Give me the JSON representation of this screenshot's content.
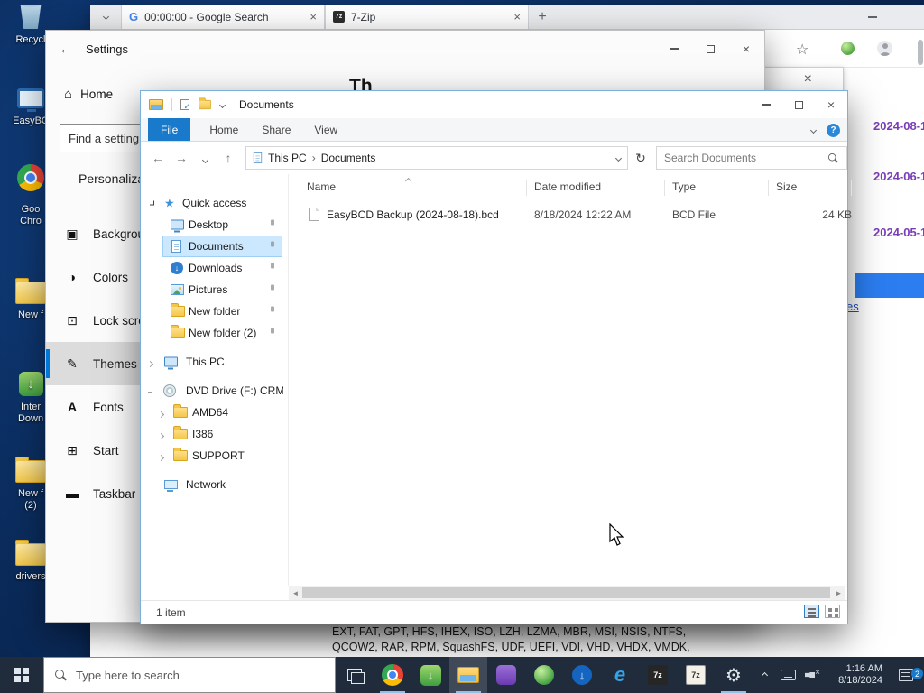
{
  "browser": {
    "tabs": [
      {
        "title": "00:00:00 - Google Search",
        "favicon": "G"
      },
      {
        "title": "7-Zip",
        "favicon": "7z"
      }
    ],
    "page": {
      "history_dates": [
        "2024-08-1",
        "2024-06-1",
        "2024-05-1"
      ],
      "selection_link_fragment": "es",
      "formats_lines": [
        "EXT, FAT, GPT, HFS, IHEX, ISO, LZH, LZMA, MBR, MSI, NSIS, NTFS,",
        "QCOW2, RAR, RPM, SquashFS, UDF, UEFI, VDI, VHD, VHDX, VMDK,"
      ]
    }
  },
  "settings": {
    "title": "Settings",
    "home_label": "Home",
    "search_placeholder": "Find a setting",
    "section_heading": "Personalization",
    "nav_items": [
      {
        "label": "Background"
      },
      {
        "label": "Colors"
      },
      {
        "label": "Lock screen"
      },
      {
        "label": "Themes"
      },
      {
        "label": "Fonts"
      },
      {
        "label": "Start"
      },
      {
        "label": "Taskbar"
      }
    ],
    "content_heading_fragment": "Th"
  },
  "explorer": {
    "title": "Documents",
    "ribbon_tabs": [
      "File",
      "Home",
      "Share",
      "View"
    ],
    "breadcrumb": {
      "root": "This PC",
      "current": "Documents"
    },
    "search_placeholder": "Search Documents",
    "columns": [
      "Name",
      "Date modified",
      "Type",
      "Size"
    ],
    "file": {
      "name": "EasyBCD Backup (2024-08-18).bcd",
      "date_modified": "8/18/2024 12:22 AM",
      "type": "BCD File",
      "size": "24 KB"
    },
    "nav": {
      "quick_access": "Quick access",
      "desktop": "Desktop",
      "documents": "Documents",
      "downloads": "Downloads",
      "pictures": "Pictures",
      "new_folder": "New folder",
      "new_folder_2": "New folder (2)",
      "this_pc": "This PC",
      "dvd_drive": "DVD Drive (F:) CRMP",
      "amd64": "AMD64",
      "i386": "I386",
      "support": "SUPPORT",
      "network": "Network"
    },
    "status": "1 item"
  },
  "desktop_icons": {
    "recycle_bin": [
      "Recycl"
    ],
    "easybcd": [
      "EasyBC"
    ],
    "chrome": [
      "Goo",
      "Chro"
    ],
    "new_folder": [
      "New f"
    ],
    "idm": [
      "Inter",
      "Down"
    ],
    "new_folder_2": [
      "New f",
      "(2)"
    ],
    "drivers": [
      "drivers"
    ]
  },
  "taskbar": {
    "search_placeholder": "Type here to search",
    "clock_time": "1:16 AM",
    "clock_date": "8/18/2024",
    "notification_badge": "2"
  },
  "glyphs": {
    "sevenzip": "7z",
    "ie": "e"
  }
}
